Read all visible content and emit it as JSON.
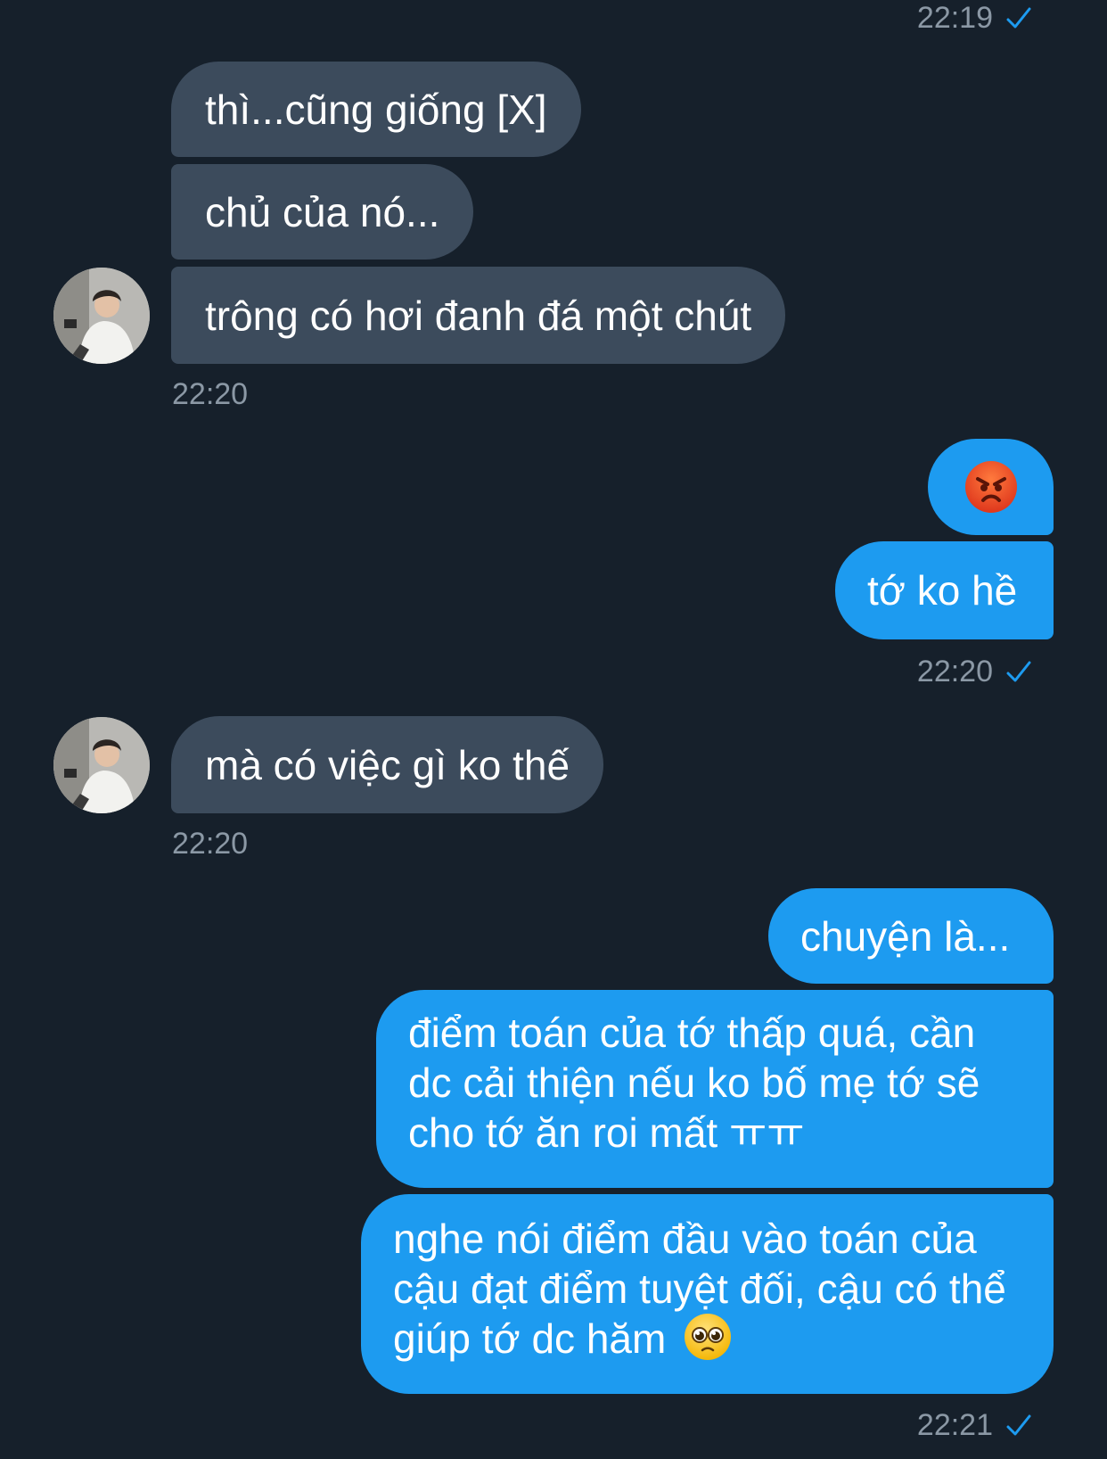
{
  "messages": {
    "top_time": "22:19",
    "m1": "thì...cũng giống [X]",
    "m2": "chủ của nó...",
    "m3": "trông có hơi đanh đá một chút",
    "time_in_1": "22:20",
    "out_emoji": "angry-face-emoji",
    "m4": "tớ ko hề",
    "time_out_1": "22:20",
    "m5": "mà có việc gì ko thế",
    "time_in_2": "22:20",
    "m6": "chuyện là...",
    "m7": "điểm toán của tớ thấp quá, cần dc cải thiện nếu ko bố mẹ tớ sẽ cho tớ ăn roi mất ㅠㅠ",
    "m8": "nghe nói điểm đầu vào toán của cậu đạt điểm tuyệt đối, cậu có thể giúp tớ dc hăm",
    "m8_emoji": "pleading-face-emoji",
    "time_out_2": "22:21"
  },
  "colors": {
    "background": "#16202b",
    "incoming_bubble": "#3c4b5c",
    "outgoing_bubble": "#1d9bf0",
    "timestamp": "#8b98a5",
    "check": "#1d9bf0"
  }
}
